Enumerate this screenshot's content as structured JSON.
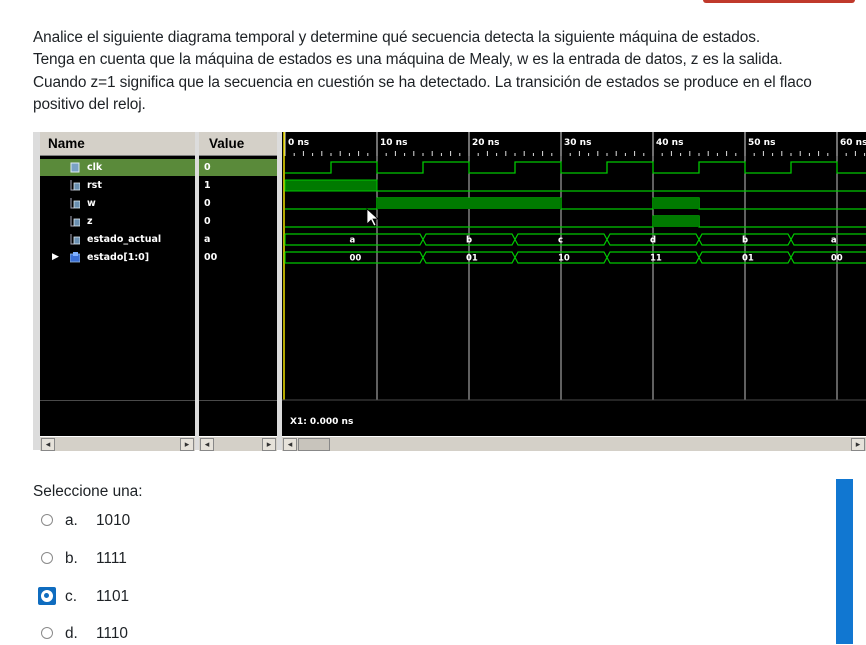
{
  "question": {
    "lines": [
      "Analice el siguiente diagrama temporal y determine qué secuencia detecta la siguiente máquina de estados.",
      "Tenga en cuenta que la máquina de estados es una máquina de Mealy, w es la entrada de datos, z es la salida.",
      "Cuando z=1 significa que la secuencia en cuestión se ha detectado. La transición de estados se produce en el flaco",
      "positivo del reloj."
    ]
  },
  "viewer": {
    "name_header": "Name",
    "value_header": "Value",
    "signals": [
      {
        "name": "clk",
        "value": "0"
      },
      {
        "name": "rst",
        "value": "1"
      },
      {
        "name": "w",
        "value": "0"
      },
      {
        "name": "z",
        "value": "0"
      },
      {
        "name": "estado_actual",
        "value": "a"
      },
      {
        "name": "estado[1:0]",
        "value": "00"
      }
    ],
    "time_ticks": [
      "0 ns",
      "10 ns",
      "20 ns",
      "30 ns",
      "40 ns",
      "50 ns",
      "60 ns"
    ],
    "estado_actual_labels": [
      "a",
      "b",
      "c",
      "d",
      "b",
      "a"
    ],
    "estado_labels": [
      "00",
      "01",
      "10",
      "11",
      "01",
      "00"
    ],
    "cursor_readout": "X1: 0.000 ns",
    "wave_color": "#00c800",
    "grid_color": "#c0c0c0"
  },
  "answer": {
    "prompt": "Seleccione una:",
    "options": [
      {
        "letter": "a.",
        "text": "1010",
        "selected": false
      },
      {
        "letter": "b.",
        "text": "1111",
        "selected": false
      },
      {
        "letter": "c.",
        "text": "1101",
        "selected": true
      },
      {
        "letter": "d.",
        "text": "1110",
        "selected": false
      }
    ]
  },
  "colors": {
    "accent": "#1177d1",
    "selected_row": "#5a8a3a",
    "top_accent": "#c0392b"
  }
}
